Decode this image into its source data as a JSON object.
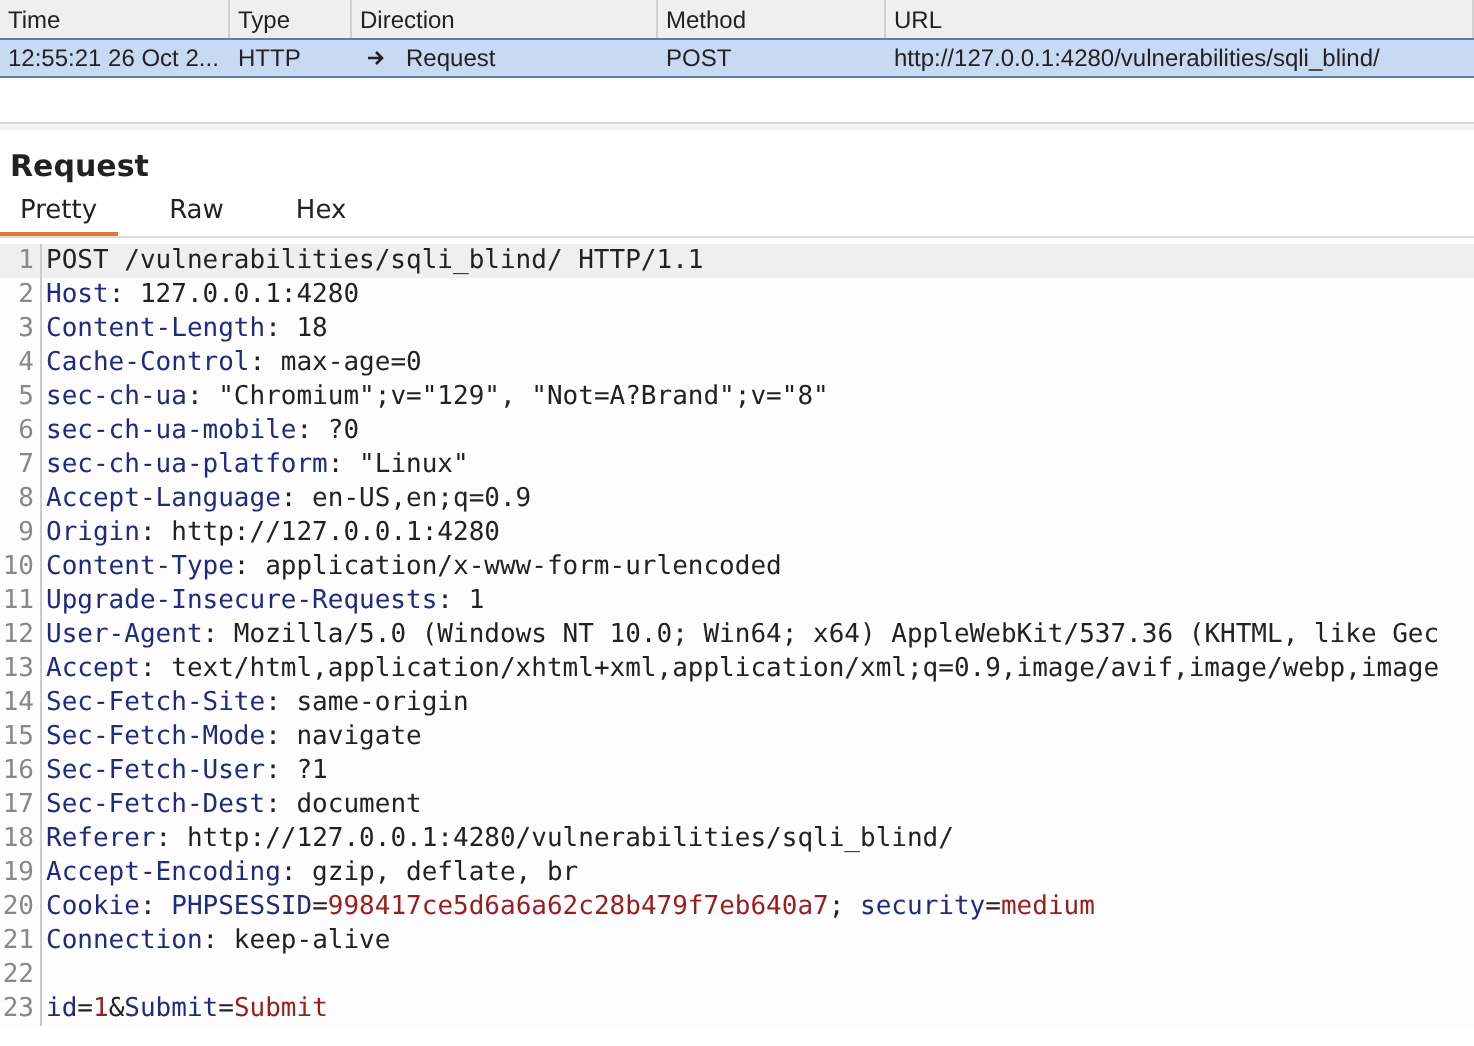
{
  "table": {
    "columns": [
      "Time",
      "Type",
      "Direction",
      "Method",
      "URL"
    ],
    "rows": [
      {
        "selected": true,
        "time": "12:55:21 26 Oct 2...",
        "type": "HTTP",
        "direction": "Request",
        "method": "POST",
        "url": "http://127.0.0.1:4280/vulnerabilities/sqli_blind/"
      }
    ]
  },
  "panel": {
    "title": "Request",
    "tabs": [
      {
        "label": "Pretty",
        "selected": true
      },
      {
        "label": "Raw",
        "selected": false
      },
      {
        "label": "Hex",
        "selected": false
      }
    ],
    "lines": [
      {
        "number": "1",
        "highlighted": true,
        "segments": [
          {
            "kind": "text",
            "text": "POST /vulnerabilities/sqli_blind/ HTTP/1.1"
          }
        ]
      },
      {
        "number": "2",
        "highlighted": false,
        "segments": [
          {
            "kind": "name",
            "text": "Host"
          },
          {
            "kind": "text",
            "text": ": 127.0.0.1:4280"
          }
        ]
      },
      {
        "number": "3",
        "highlighted": false,
        "segments": [
          {
            "kind": "name",
            "text": "Content-Length"
          },
          {
            "kind": "text",
            "text": ": 18"
          }
        ]
      },
      {
        "number": "4",
        "highlighted": false,
        "segments": [
          {
            "kind": "name",
            "text": "Cache-Control"
          },
          {
            "kind": "text",
            "text": ": max-age=0"
          }
        ]
      },
      {
        "number": "5",
        "highlighted": false,
        "segments": [
          {
            "kind": "name",
            "text": "sec-ch-ua"
          },
          {
            "kind": "text",
            "text": ": \"Chromium\";v=\"129\", \"Not=A?Brand\";v=\"8\""
          }
        ]
      },
      {
        "number": "6",
        "highlighted": false,
        "segments": [
          {
            "kind": "name",
            "text": "sec-ch-ua-mobile"
          },
          {
            "kind": "text",
            "text": ": ?0"
          }
        ]
      },
      {
        "number": "7",
        "highlighted": false,
        "segments": [
          {
            "kind": "name",
            "text": "sec-ch-ua-platform"
          },
          {
            "kind": "text",
            "text": ": \"Linux\""
          }
        ]
      },
      {
        "number": "8",
        "highlighted": false,
        "segments": [
          {
            "kind": "name",
            "text": "Accept-Language"
          },
          {
            "kind": "text",
            "text": ": en-US,en;q=0.9"
          }
        ]
      },
      {
        "number": "9",
        "highlighted": false,
        "segments": [
          {
            "kind": "name",
            "text": "Origin"
          },
          {
            "kind": "text",
            "text": ": http://127.0.0.1:4280"
          }
        ]
      },
      {
        "number": "10",
        "highlighted": false,
        "segments": [
          {
            "kind": "name",
            "text": "Content-Type"
          },
          {
            "kind": "text",
            "text": ": application/x-www-form-urlencoded"
          }
        ]
      },
      {
        "number": "11",
        "highlighted": false,
        "segments": [
          {
            "kind": "name",
            "text": "Upgrade-Insecure-Requests"
          },
          {
            "kind": "text",
            "text": ": 1"
          }
        ]
      },
      {
        "number": "12",
        "highlighted": false,
        "segments": [
          {
            "kind": "name",
            "text": "User-Agent"
          },
          {
            "kind": "text",
            "text": ": Mozilla/5.0 (Windows NT 10.0; Win64; x64) AppleWebKit/537.36 (KHTML, like Gec"
          }
        ]
      },
      {
        "number": "13",
        "highlighted": false,
        "segments": [
          {
            "kind": "name",
            "text": "Accept"
          },
          {
            "kind": "text",
            "text": ": text/html,application/xhtml+xml,application/xml;q=0.9,image/avif,image/webp,image"
          }
        ]
      },
      {
        "number": "14",
        "highlighted": false,
        "segments": [
          {
            "kind": "name",
            "text": "Sec-Fetch-Site"
          },
          {
            "kind": "text",
            "text": ": same-origin"
          }
        ]
      },
      {
        "number": "15",
        "highlighted": false,
        "segments": [
          {
            "kind": "name",
            "text": "Sec-Fetch-Mode"
          },
          {
            "kind": "text",
            "text": ": navigate"
          }
        ]
      },
      {
        "number": "16",
        "highlighted": false,
        "segments": [
          {
            "kind": "name",
            "text": "Sec-Fetch-User"
          },
          {
            "kind": "text",
            "text": ": ?1"
          }
        ]
      },
      {
        "number": "17",
        "highlighted": false,
        "segments": [
          {
            "kind": "name",
            "text": "Sec-Fetch-Dest"
          },
          {
            "kind": "text",
            "text": ": document"
          }
        ]
      },
      {
        "number": "18",
        "highlighted": false,
        "segments": [
          {
            "kind": "name",
            "text": "Referer"
          },
          {
            "kind": "text",
            "text": ": http://127.0.0.1:4280/vulnerabilities/sqli_blind/"
          }
        ]
      },
      {
        "number": "19",
        "highlighted": false,
        "segments": [
          {
            "kind": "name",
            "text": "Accept-Encoding"
          },
          {
            "kind": "text",
            "text": ": gzip, deflate, br"
          }
        ]
      },
      {
        "number": "20",
        "highlighted": false,
        "segments": [
          {
            "kind": "name",
            "text": "Cookie"
          },
          {
            "kind": "text",
            "text": ": "
          },
          {
            "kind": "name",
            "text": "PHPSESSID"
          },
          {
            "kind": "text",
            "text": "="
          },
          {
            "kind": "value",
            "text": "998417ce5d6a6a62c28b479f7eb640a7"
          },
          {
            "kind": "text",
            "text": "; "
          },
          {
            "kind": "name",
            "text": "security"
          },
          {
            "kind": "text",
            "text": "="
          },
          {
            "kind": "value",
            "text": "medium"
          }
        ]
      },
      {
        "number": "21",
        "highlighted": false,
        "segments": [
          {
            "kind": "name",
            "text": "Connection"
          },
          {
            "kind": "text",
            "text": ": keep-alive"
          }
        ]
      },
      {
        "number": "22",
        "highlighted": false
      },
      {
        "number": "23",
        "highlighted": false,
        "segments": [
          {
            "kind": "name",
            "text": "id"
          },
          {
            "kind": "text",
            "text": "="
          },
          {
            "kind": "value",
            "text": "1"
          },
          {
            "kind": "text",
            "text": "&"
          },
          {
            "kind": "name",
            "text": "Submit"
          },
          {
            "kind": "text",
            "text": "="
          },
          {
            "kind": "value",
            "text": "Submit"
          }
        ]
      }
    ]
  }
}
